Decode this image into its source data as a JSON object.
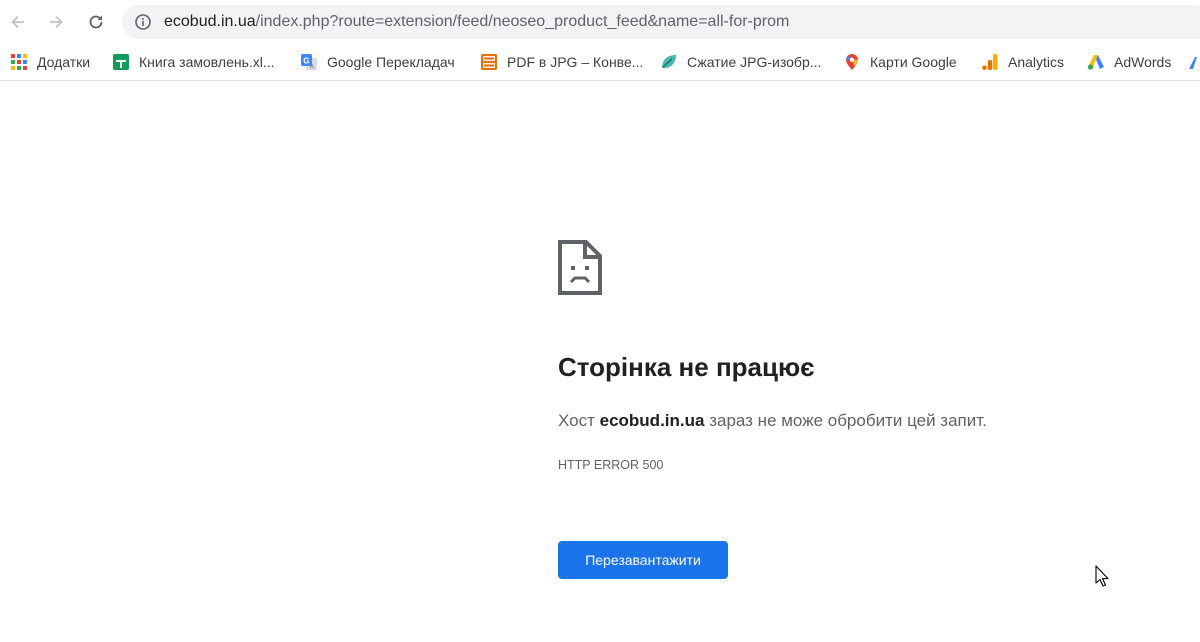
{
  "browser": {
    "url_host": "ecobud.in.ua",
    "url_path": "/index.php?route=extension/feed/neoseo_product_feed&name=all-for-prom",
    "nav_icons": [
      "back-arrow-icon",
      "forward-arrow-icon",
      "reload-icon",
      "info-icon"
    ]
  },
  "bookmarks": [
    {
      "label": "Додатки",
      "icon": "apps-grid-icon"
    },
    {
      "label": "Книга замовлень.xl...",
      "icon": "google-sheets-icon"
    },
    {
      "label": "Google Перекладач",
      "icon": "google-translate-icon"
    },
    {
      "label": "PDF в JPG – Конве...",
      "icon": "pdf-to-jpg-icon"
    },
    {
      "label": "Сжатие JPG-изобр...",
      "icon": "leaf-icon"
    },
    {
      "label": "Карти Google",
      "icon": "maps-pin-icon"
    },
    {
      "label": "Analytics",
      "icon": "analytics-icon"
    },
    {
      "label": "AdWords",
      "icon": "adwords-icon"
    }
  ],
  "error_page": {
    "heading": "Сторінка не працює",
    "summary_prefix": "Хост ",
    "summary_host": "ecobud.in.ua",
    "summary_suffix": " зараз не може обробити цей запит.",
    "error_code": "HTTP ERROR 500",
    "reload_button": "Перезавантажити",
    "icon": "sad-page-icon"
  },
  "colors": {
    "primary_button": "#1a73e8",
    "heading_text": "#202124",
    "secondary_text": "#5f6368",
    "omnibox_bg": "#f1f3f4"
  }
}
